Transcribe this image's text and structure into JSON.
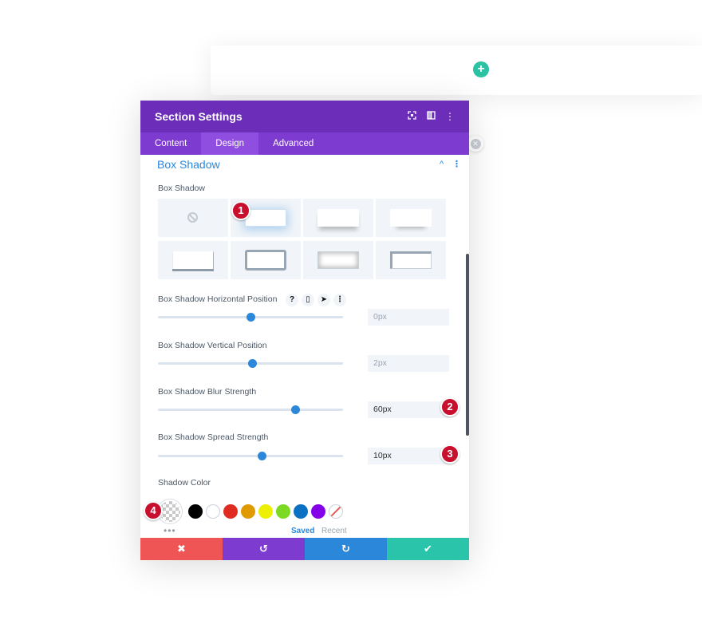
{
  "panel": {
    "title": "Section Settings",
    "tabs": [
      {
        "label": "Content",
        "active": false
      },
      {
        "label": "Design",
        "active": true
      },
      {
        "label": "Advanced",
        "active": false
      }
    ]
  },
  "group": {
    "title": "Box Shadow"
  },
  "box_shadow": {
    "label": "Box Shadow",
    "selected_preset": 1
  },
  "fields": {
    "horizontal": {
      "label": "Box Shadow Horizontal Position",
      "value": "0px",
      "slider_fraction": 0.5
    },
    "vertical": {
      "label": "Box Shadow Vertical Position",
      "value": "2px",
      "slider_fraction": 0.51
    },
    "blur": {
      "label": "Box Shadow Blur Strength",
      "value": "60px",
      "slider_fraction": 0.74
    },
    "spread": {
      "label": "Box Shadow Spread Strength",
      "value": "10px",
      "slider_fraction": 0.56
    }
  },
  "color": {
    "label": "Shadow Color",
    "swatches": [
      "#000000",
      "#ffffff",
      "#e02b20",
      "#e09900",
      "#edf000",
      "#7cda24",
      "#0c71c3",
      "#8300e9"
    ],
    "saved_label": "Saved",
    "recent_label": "Recent"
  },
  "footer": {
    "cancel": "✖",
    "undo": "↺",
    "redo": "↻",
    "save": "✔"
  },
  "badges": [
    "1",
    "2",
    "3",
    "4"
  ]
}
